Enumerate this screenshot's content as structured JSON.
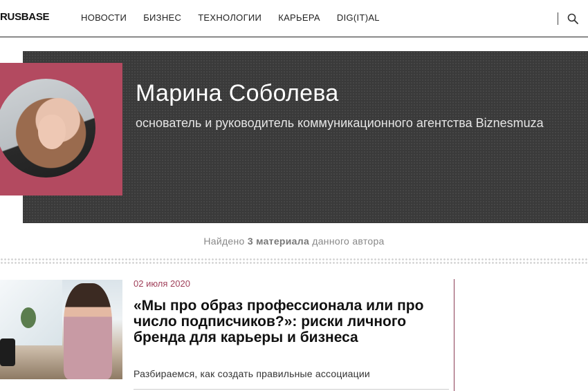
{
  "header": {
    "logo": "RUSBASE",
    "nav": [
      "НОВОСТИ",
      "БИЗНЕС",
      "ТЕХНОЛОГИИ",
      "КАРЬЕРА",
      "DIG(IT)AL"
    ],
    "search_icon": "search-icon"
  },
  "author": {
    "name": "Марина Соболева",
    "role": "основатель и руководитель коммуникационного агентства Biznesmuza",
    "accent_color": "#b34a60"
  },
  "found": {
    "prefix": "Найдено",
    "count": "3 материала",
    "suffix": "данного автора"
  },
  "article": {
    "date": "02 июля 2020",
    "title": "«Мы про образ профессионала или про число подписчиков?»: риски личного бренда для карьеры и бизнеса",
    "lead": "Разбираемся, как создать правильные ассоциации",
    "date_color": "#a0405a"
  }
}
